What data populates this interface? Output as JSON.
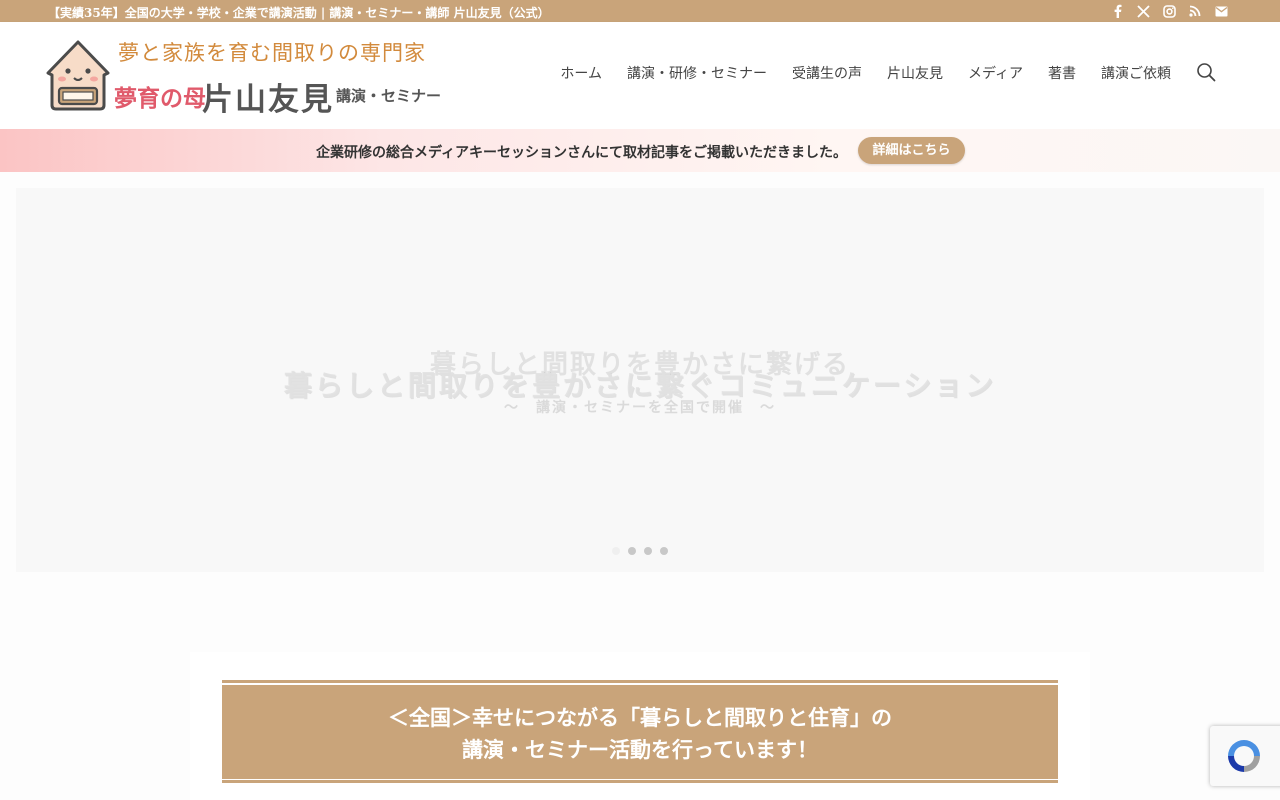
{
  "topbar": {
    "tagline": "【実績35年】全国の大学・学校・企業で講演活動 | 講演・セミナー・講師 片山友見（公式）",
    "socials": [
      "facebook-icon",
      "x-icon",
      "instagram-icon",
      "rss-icon",
      "mail-icon"
    ]
  },
  "logo": {
    "tagline": "夢と家族を育む間取りの専門家",
    "brand": "夢育の母",
    "name": "片山友見",
    "subtitle": "講演・セミナー"
  },
  "nav": {
    "items": [
      "ホーム",
      "講演・研修・セミナー",
      "受講生の声",
      "片山友見",
      "メディア",
      "著書",
      "講演ご依頼"
    ]
  },
  "notice": {
    "text": "企業研修の総合メディアキーセッションさんにて取材記事をご掲載いただきました。",
    "button": "詳細はこちら"
  },
  "slider": {
    "title_a": "暮らしと間取りを豊かさに繋げる",
    "title_b": "暮らしと間取りを豊かさに繋ぐコミュニケーション",
    "subtitle": "〜　講演・セミナーを全国で開催　〜",
    "dots": 4,
    "active_dot": 0
  },
  "content": {
    "heading_line1": "＜全国＞幸せにつながる「暮らしと間取りと住育」の",
    "heading_line2": "講演・セミナー活動を行っています！"
  },
  "colors": {
    "accent": "#c9a47a",
    "brand_pink": "#e05a6b",
    "tag_orange": "#d28a3c"
  }
}
